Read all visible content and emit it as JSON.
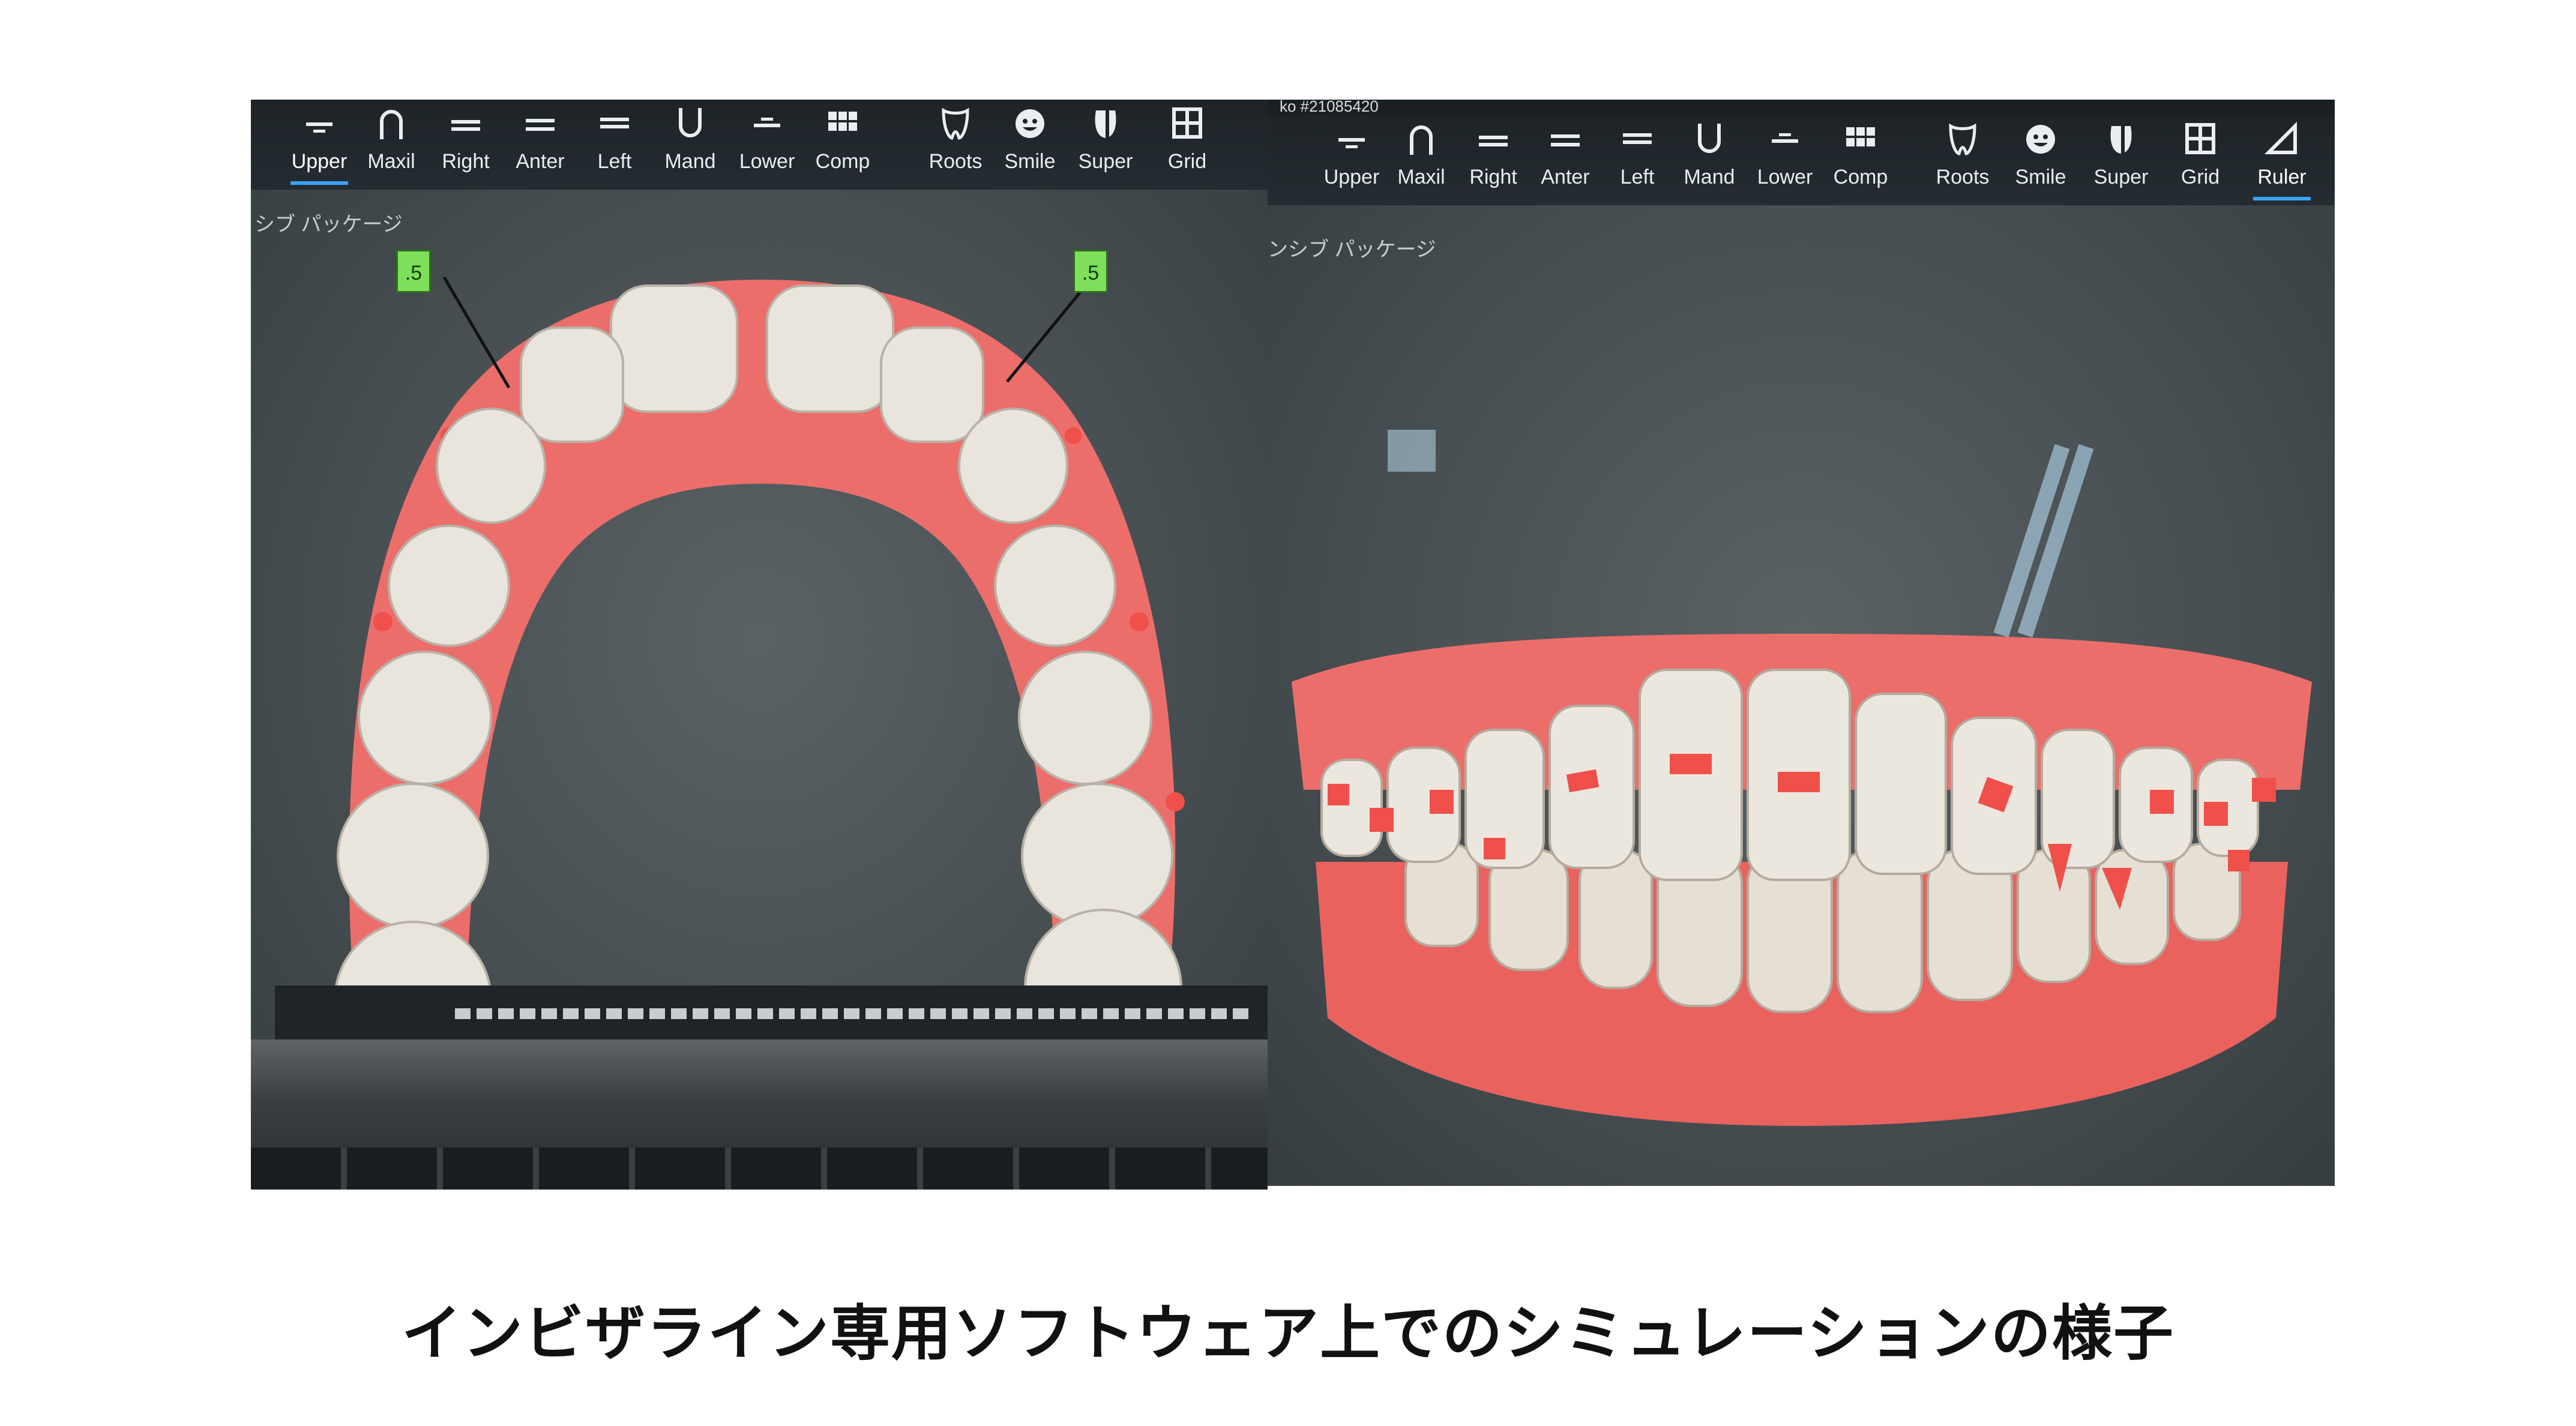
{
  "left_panel": {
    "toolbar": [
      {
        "id": "upper",
        "label": "Upper",
        "icon": "upper-view-icon",
        "active": true
      },
      {
        "id": "maxil",
        "label": "Maxil",
        "icon": "maxillary-arch-icon"
      },
      {
        "id": "right",
        "label": "Right",
        "icon": "right-view-icon"
      },
      {
        "id": "anter",
        "label": "Anter",
        "icon": "anterior-view-icon"
      },
      {
        "id": "left",
        "label": "Left",
        "icon": "left-view-icon"
      },
      {
        "id": "mand",
        "label": "Mand",
        "icon": "mandibular-arch-icon"
      },
      {
        "id": "lower",
        "label": "Lower",
        "icon": "lower-view-icon"
      },
      {
        "id": "comp",
        "label": "Comp",
        "icon": "compare-grid-icon"
      },
      {
        "id": "roots",
        "label": "Roots",
        "icon": "tooth-roots-icon"
      },
      {
        "id": "smile",
        "label": "Smile",
        "icon": "smile-face-icon"
      },
      {
        "id": "super",
        "label": "Super",
        "icon": "superimpose-icon"
      },
      {
        "id": "grid",
        "label": "Grid",
        "icon": "grid-icon"
      }
    ],
    "package_label": "シブ パッケージ",
    "tags": [
      ".5",
      ".5"
    ]
  },
  "right_panel": {
    "header_text": "ko #21085420",
    "toolbar": [
      {
        "id": "upper",
        "label": "Upper",
        "icon": "upper-view-icon"
      },
      {
        "id": "maxil",
        "label": "Maxil",
        "icon": "maxillary-arch-icon"
      },
      {
        "id": "right",
        "label": "Right",
        "icon": "right-view-icon"
      },
      {
        "id": "anter",
        "label": "Anter",
        "icon": "anterior-view-icon"
      },
      {
        "id": "left",
        "label": "Left",
        "icon": "left-view-icon"
      },
      {
        "id": "mand",
        "label": "Mand",
        "icon": "mandibular-arch-icon"
      },
      {
        "id": "lower",
        "label": "Lower",
        "icon": "lower-view-icon"
      },
      {
        "id": "comp",
        "label": "Comp",
        "icon": "compare-grid-icon"
      },
      {
        "id": "roots",
        "label": "Roots",
        "icon": "tooth-roots-icon"
      },
      {
        "id": "smile",
        "label": "Smile",
        "icon": "smile-face-icon"
      },
      {
        "id": "super",
        "label": "Super",
        "icon": "superimpose-icon"
      },
      {
        "id": "grid",
        "label": "Grid",
        "icon": "grid-icon"
      },
      {
        "id": "ruler",
        "label": "Ruler",
        "icon": "ruler-icon"
      }
    ],
    "package_label": "ンシブ パッケージ"
  },
  "caption": "インビザライン専用ソフトウェア上でのシミュレーションの様子",
  "colors": {
    "gum": "#ec6e6a",
    "tooth": "#e9e4dc",
    "attachment": "#f0504a",
    "tag": "#7ee05a",
    "toolbar": "#1d2327"
  }
}
